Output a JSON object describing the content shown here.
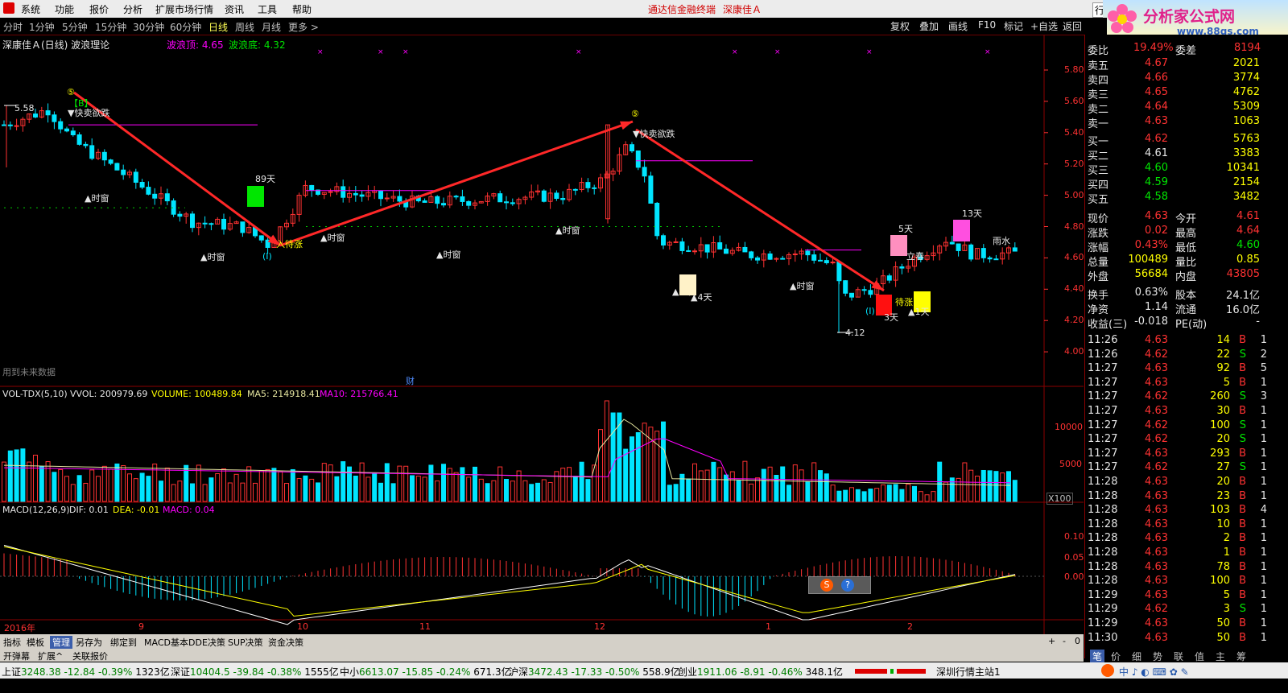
{
  "menu": {
    "items": [
      "系统",
      "功能",
      "报价",
      "分析",
      "扩展市场行情",
      "资讯",
      "工具",
      "帮助"
    ],
    "center_title": "通达信金融终端",
    "center_stock": "深康佳Ａ",
    "right_label": "行"
  },
  "logo": {
    "title": "分析家公式网",
    "url": "www.88gs.com"
  },
  "toolbar": {
    "periods": [
      "分时",
      "1分钟",
      "5分钟",
      "15分钟",
      "30分钟",
      "60分钟",
      "日线",
      "周线",
      "月线",
      "更多 >"
    ],
    "active_period": "日线",
    "buttons": [
      "复权",
      "叠加",
      "画线",
      "F10",
      "标记",
      "+自选",
      "返回"
    ]
  },
  "main_chart": {
    "title": "深康佳Ａ(日线) 波浪理论",
    "wave_top_label": "波浪顶: 4.65",
    "wave_bottom_label": "波浪底: 4.32",
    "price_ticks": [
      "5.80",
      "5.60",
      "5.40",
      "5.20",
      "5.00",
      "4.80",
      "4.60",
      "4.40",
      "4.20",
      "4.00"
    ],
    "annotations": {
      "high_label": "5.58",
      "low_label": "4.12",
      "circle5_a": "⑤",
      "circle5_b": "⑤",
      "b_marker": "【B】",
      "sell1": "▼快卖欲跌",
      "sell2": "▼快卖欲跌",
      "buy1": "入待涨",
      "buy2": "待涨",
      "wave1": "(I)",
      "wave2": "(I)",
      "window1": "▲时窗",
      "window2": "▲时窗",
      "window3": "▲时窗",
      "window4": "▲时窗",
      "window5": "▲时窗",
      "window6": "▲时窗",
      "window7": "▲时窗",
      "days89": "89天",
      "days4": "▲4天",
      "days5": "5天",
      "days13": "13天",
      "days3": "3天",
      "days_b": "▲1天",
      "spring": "立春",
      "rain": "雨水",
      "future_data": "用到未来数据",
      "cai": "财"
    }
  },
  "volume_chart": {
    "title": "VOL-TDX(5,10)",
    "vvol": "VVOL: 200979.69",
    "volume": "VOLUME: 100489.84",
    "ma5": "MA5: 214918.41",
    "ma10": "MA10: 215766.41",
    "ticks": [
      "10000",
      "5000"
    ],
    "unit": "X100"
  },
  "macd_chart": {
    "title": "MACD(12,26,9)",
    "dif": "DIF: 0.01",
    "dea": "DEA: -0.01",
    "macd": "MACD: 0.04",
    "ticks": [
      "0.10",
      "0.05",
      "0.00"
    ]
  },
  "x_axis": {
    "labels": [
      "2016年",
      "9",
      "10",
      "11",
      "12",
      "1",
      "2"
    ]
  },
  "bottom_tabs": [
    "指标",
    "模板",
    "管理",
    "另存为",
    "绑定到",
    "MACD基本",
    "DDE决策",
    "SUP决策",
    "资金决策"
  ],
  "bottom_tabs_active": "管理",
  "bottom_tabs2": [
    "开弹幕",
    "扩展^",
    "关联报价"
  ],
  "bottom_controls": [
    "+",
    "-",
    "0"
  ],
  "quote": {
    "webi_label": "委比",
    "webi_val": "19.49%",
    "wecha_label": "委差",
    "wecha_val": "8194",
    "asks": [
      {
        "label": "卖五",
        "price": "4.67",
        "vol": "2021"
      },
      {
        "label": "卖四",
        "price": "4.66",
        "vol": "3774"
      },
      {
        "label": "卖三",
        "price": "4.65",
        "vol": "4762"
      },
      {
        "label": "卖二",
        "price": "4.64",
        "vol": "5309"
      },
      {
        "label": "卖一",
        "price": "4.63",
        "vol": "1063"
      }
    ],
    "bids": [
      {
        "label": "买一",
        "price": "4.62",
        "vol": "5763"
      },
      {
        "label": "买二",
        "price": "4.61",
        "vol": "3383"
      },
      {
        "label": "买三",
        "price": "4.60",
        "vol": "10341"
      },
      {
        "label": "买四",
        "price": "4.59",
        "vol": "2154"
      },
      {
        "label": "买五",
        "price": "4.58",
        "vol": "3482"
      }
    ],
    "stats": [
      {
        "l1": "现价",
        "v1": "4.63",
        "l2": "今开",
        "v2": "4.61"
      },
      {
        "l1": "涨跌",
        "v1": "0.02",
        "l2": "最高",
        "v2": "4.64"
      },
      {
        "l1": "涨幅",
        "v1": "0.43%",
        "l2": "最低",
        "v2": "4.60"
      },
      {
        "l1": "总量",
        "v1": "100489",
        "l2": "量比",
        "v2": "0.85"
      },
      {
        "l1": "外盘",
        "v1": "56684",
        "l2": "内盘",
        "v2": "43805"
      }
    ],
    "stats2": [
      {
        "l1": "换手",
        "v1": "0.63%",
        "l2": "股本",
        "v2": "24.1亿"
      },
      {
        "l1": "净资",
        "v1": "1.14",
        "l2": "流通",
        "v2": "16.0亿"
      },
      {
        "l1": "收益(三)",
        "v1": "-0.018",
        "l2": "PE(动)",
        "v2": "-"
      }
    ]
  },
  "ticks": [
    {
      "t": "11:26",
      "p": "4.63",
      "v": "14",
      "s": "B",
      "n": "1"
    },
    {
      "t": "11:26",
      "p": "4.62",
      "v": "22",
      "s": "S",
      "n": "2"
    },
    {
      "t": "11:27",
      "p": "4.63",
      "v": "92",
      "s": "B",
      "n": "5"
    },
    {
      "t": "11:27",
      "p": "4.63",
      "v": "5",
      "s": "B",
      "n": "1"
    },
    {
      "t": "11:27",
      "p": "4.62",
      "v": "260",
      "s": "S",
      "n": "3"
    },
    {
      "t": "11:27",
      "p": "4.63",
      "v": "30",
      "s": "B",
      "n": "1"
    },
    {
      "t": "11:27",
      "p": "4.62",
      "v": "100",
      "s": "S",
      "n": "1"
    },
    {
      "t": "11:27",
      "p": "4.62",
      "v": "20",
      "s": "S",
      "n": "1"
    },
    {
      "t": "11:27",
      "p": "4.63",
      "v": "293",
      "s": "B",
      "n": "1"
    },
    {
      "t": "11:27",
      "p": "4.62",
      "v": "27",
      "s": "S",
      "n": "1"
    },
    {
      "t": "11:28",
      "p": "4.63",
      "v": "20",
      "s": "B",
      "n": "1"
    },
    {
      "t": "11:28",
      "p": "4.63",
      "v": "23",
      "s": "B",
      "n": "1"
    },
    {
      "t": "11:28",
      "p": "4.63",
      "v": "103",
      "s": "B",
      "n": "4"
    },
    {
      "t": "11:28",
      "p": "4.63",
      "v": "10",
      "s": "B",
      "n": "1"
    },
    {
      "t": "11:28",
      "p": "4.63",
      "v": "2",
      "s": "B",
      "n": "1"
    },
    {
      "t": "11:28",
      "p": "4.63",
      "v": "1",
      "s": "B",
      "n": "1"
    },
    {
      "t": "11:28",
      "p": "4.63",
      "v": "78",
      "s": "B",
      "n": "1"
    },
    {
      "t": "11:28",
      "p": "4.63",
      "v": "100",
      "s": "B",
      "n": "1"
    },
    {
      "t": "11:29",
      "p": "4.63",
      "v": "5",
      "s": "B",
      "n": "1"
    },
    {
      "t": "11:29",
      "p": "4.62",
      "v": "3",
      "s": "S",
      "n": "1"
    },
    {
      "t": "11:29",
      "p": "4.63",
      "v": "50",
      "s": "B",
      "n": "1"
    },
    {
      "t": "11:30",
      "p": "4.63",
      "v": "50",
      "s": "B",
      "n": "1"
    }
  ],
  "panel_tabs": [
    "笔",
    "价",
    "细",
    "势",
    "联",
    "值",
    "主",
    "筹"
  ],
  "statusbar": {
    "items": [
      {
        "name": "上证",
        "val": "3248.38",
        "chg": "-12.84",
        "pct": "-0.39%",
        "amt": "1323亿"
      },
      {
        "name": "深证",
        "val": "10404.5",
        "chg": "-39.84",
        "pct": "-0.38%",
        "amt": "1555亿"
      },
      {
        "name": "中小",
        "val": "6613.07",
        "chg": "-15.85",
        "pct": "-0.24%",
        "amt": "671.3亿"
      },
      {
        "name": "沪深",
        "val": "3472.43",
        "chg": "-17.33",
        "pct": "-0.50%",
        "amt": "558.9亿"
      },
      {
        "name": "创业",
        "val": "1911.06",
        "chg": "-8.91",
        "pct": "-0.46%",
        "amt": "348.1亿"
      }
    ],
    "server": "深圳行情主站1"
  },
  "colors": {
    "up": "#ff3232",
    "down": "#00e5ff",
    "ma5": "#ffffff",
    "ma10": "#ffff00",
    "ma20": "#ff00ff",
    "grid": "#8b0000"
  }
}
